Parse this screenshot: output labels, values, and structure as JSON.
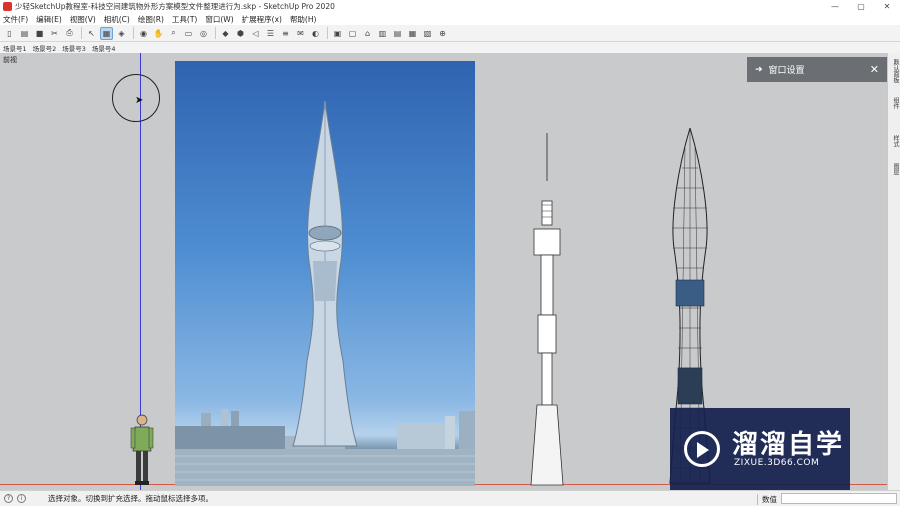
{
  "window": {
    "title": "少轻SketchUp教程室-科技空间建筑物外形方案模型文件整理进行为.skp - SketchUp Pro 2020",
    "controls": [
      "—",
      "▢",
      "✕"
    ]
  },
  "menu": {
    "items": [
      "文件(F)",
      "编辑(E)",
      "视图(V)",
      "相机(C)",
      "绘图(R)",
      "工具(T)",
      "窗口(W)",
      "扩展程序(x)",
      "帮助(H)"
    ]
  },
  "toolbar": {
    "buttons": [
      {
        "name": "new",
        "glyph": "▯"
      },
      {
        "name": "open",
        "glyph": "▤"
      },
      {
        "name": "save",
        "glyph": "■"
      },
      {
        "name": "cut",
        "glyph": "✂"
      },
      {
        "name": "print",
        "glyph": "⎙"
      },
      {
        "name": "select",
        "glyph": "↖"
      },
      {
        "name": "eraser",
        "glyph": "▦"
      },
      {
        "name": "paint",
        "glyph": "◈"
      },
      {
        "name": "orbit",
        "glyph": "◉"
      },
      {
        "name": "pan",
        "glyph": "✋"
      },
      {
        "name": "zoom",
        "glyph": "⌕"
      },
      {
        "name": "section",
        "glyph": "▭"
      },
      {
        "name": "camera",
        "glyph": "◎"
      },
      {
        "name": "warehouse",
        "glyph": "◆"
      },
      {
        "name": "extension",
        "glyph": "⬢"
      },
      {
        "name": "speaker",
        "glyph": "◁"
      },
      {
        "name": "styles",
        "glyph": "☰"
      },
      {
        "name": "layers",
        "glyph": "≡"
      },
      {
        "name": "message",
        "glyph": "✉"
      },
      {
        "name": "shadow",
        "glyph": "◐"
      },
      {
        "name": "views-iso",
        "glyph": "▣"
      },
      {
        "name": "views-top",
        "glyph": "▢"
      },
      {
        "name": "views-front",
        "glyph": "⌂"
      },
      {
        "name": "views-right",
        "glyph": "▥"
      },
      {
        "name": "views-back",
        "glyph": "▤"
      },
      {
        "name": "views-left",
        "glyph": "▦"
      },
      {
        "name": "views-bottom",
        "glyph": "▧"
      },
      {
        "name": "geo",
        "glyph": "⊕"
      }
    ]
  },
  "scenes": {
    "tabs": [
      "场景号1",
      "场景号2",
      "场景号3",
      "场景号4"
    ]
  },
  "viewport": {
    "view_label": "前视"
  },
  "tray": {
    "title": "窗口设置",
    "close": "✕",
    "pin": "➜"
  },
  "side_tabs": [
    "默认面板",
    "组件",
    "样式",
    "图层"
  ],
  "status": {
    "hint": "选择对象。切换到扩充选择。拖动鼠标选择多项。",
    "measure_label": "数值",
    "measure_value": ""
  },
  "watermark": {
    "name": "溜溜自学",
    "url": "ZIXUE.3D66.COM"
  },
  "colors": {
    "accent": "#3a3ad8",
    "ground": "#d05a4c",
    "background": "#c9cacc",
    "tray_header": "#6b6f73",
    "watermark_bg": "#14204e"
  }
}
